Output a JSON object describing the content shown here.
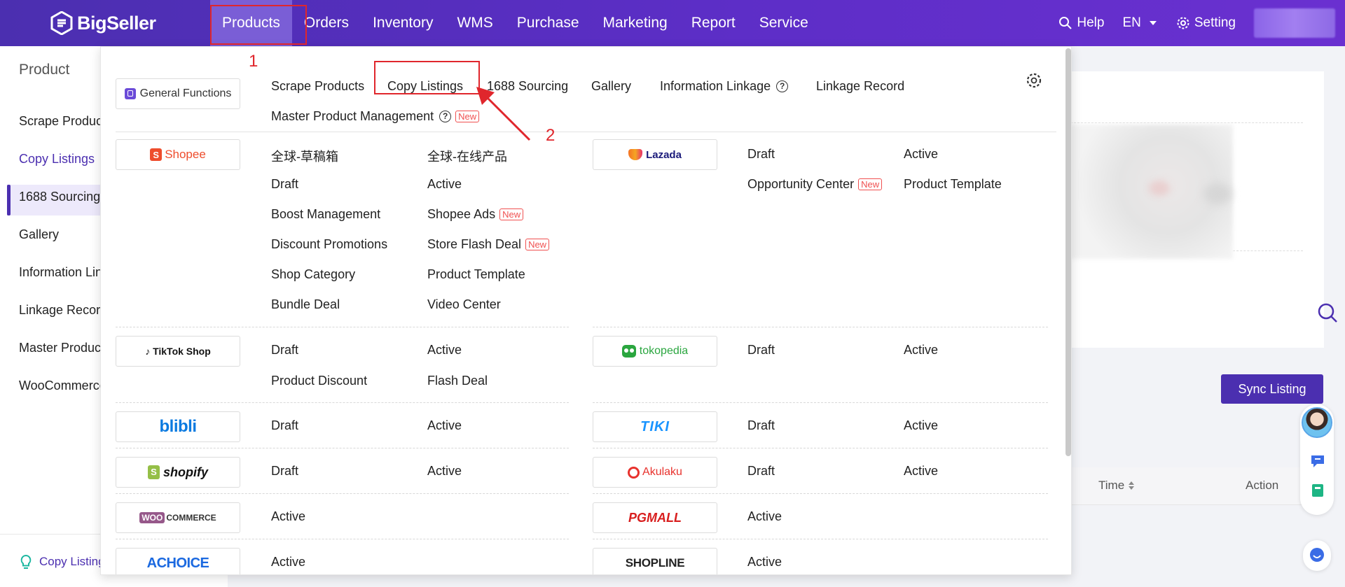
{
  "brand": {
    "name": "BigSeller"
  },
  "nav": [
    {
      "label": "Products",
      "active": true
    },
    {
      "label": "Orders"
    },
    {
      "label": "Inventory"
    },
    {
      "label": "WMS"
    },
    {
      "label": "Purchase"
    },
    {
      "label": "Marketing"
    },
    {
      "label": "Report"
    },
    {
      "label": "Service"
    }
  ],
  "topright": {
    "help": "Help",
    "lang": "EN",
    "setting": "Setting"
  },
  "sidebar": {
    "title": "Product",
    "items": [
      "Scrape Products",
      "Copy Listings",
      "1688 Sourcing",
      "Gallery",
      "Information Linkage",
      "Linkage Record",
      "Master Product Management",
      "WooCommerce"
    ],
    "active_index": 1,
    "bottom": "Copy Listings"
  },
  "dropdown": {
    "general": {
      "label": "General Functions",
      "links": [
        "Scrape Products",
        "Copy Listings",
        "1688 Sourcing",
        "Gallery",
        "Information Linkage",
        "Linkage Record",
        "Master Product Management"
      ],
      "new_badge": "New"
    },
    "shopee": {
      "name": "Shopee",
      "col1": [
        "全球-草稿箱",
        "Draft",
        "Boost Management",
        "Discount Promotions",
        "Shop Category",
        "Bundle Deal"
      ],
      "col2": [
        "全球-在线产品",
        "Active",
        "Shopee Ads",
        "Store Flash Deal",
        "Product Template",
        "Video Center"
      ]
    },
    "lazada": {
      "name": "Lazada",
      "col1": [
        "Draft",
        "Opportunity Center"
      ],
      "col2": [
        "Active",
        "Product Template"
      ]
    },
    "tiktok": {
      "name": "TikTok Shop",
      "col1": [
        "Draft",
        "Product Discount"
      ],
      "col2": [
        "Active",
        "Flash Deal"
      ]
    },
    "tokopedia": {
      "name": "tokopedia",
      "col1": [
        "Draft"
      ],
      "col2": [
        "Active"
      ]
    },
    "blibli": {
      "name": "blibli",
      "col1": [
        "Draft"
      ],
      "col2": [
        "Active"
      ]
    },
    "tiki": {
      "name": "TIKI",
      "col1": [
        "Draft"
      ],
      "col2": [
        "Active"
      ]
    },
    "shopify": {
      "name": "shopify",
      "col1": [
        "Draft"
      ],
      "col2": [
        "Active"
      ]
    },
    "akulaku": {
      "name": "Akulaku",
      "col1": [
        "Draft"
      ],
      "col2": [
        "Active"
      ]
    },
    "woocommerce": {
      "name": "COMMERCE",
      "prefix": "WOO",
      "col1": [
        "Active"
      ]
    },
    "pgmall": {
      "name": "PGMALL",
      "col1": [
        "Active"
      ]
    },
    "achoice": {
      "name": "ACHOICE",
      "col1": [
        "Active"
      ]
    },
    "shopline": {
      "name": "SHOPLINE",
      "col1": [
        "Active"
      ]
    }
  },
  "annotations": {
    "one": "1",
    "two": "2"
  },
  "content": {
    "sync_button": "Sync Listing",
    "table_time": "Time",
    "table_action": "Action"
  },
  "colors": {
    "primary": "#4b2fb0",
    "annotation": "#e0262c",
    "new_badge": "#f05050"
  }
}
